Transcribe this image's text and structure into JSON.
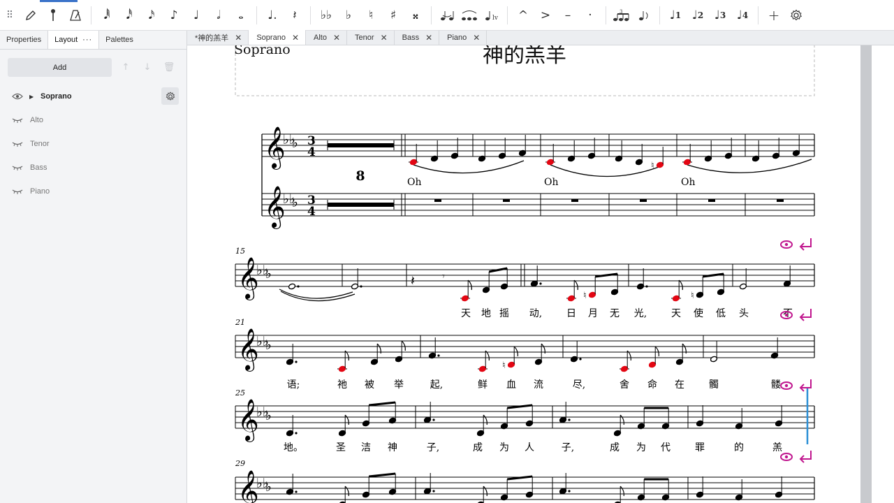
{
  "toolbar": {
    "items": [
      "pencil-icon",
      "sharp-pin-icon",
      "metronome-icon",
      "note-64th",
      "note-32nd",
      "note-16th",
      "note-8th",
      "note-quarter",
      "note-half",
      "note-whole",
      "dot",
      "rest",
      "double-flat",
      "flat",
      "natural",
      "sharp",
      "double-sharp",
      "tie",
      "slur",
      "tuplet",
      "accent-lv",
      "marcato",
      "accent",
      "tenuto",
      "staccato",
      "triplet",
      "flip",
      "voice-1",
      "voice-2",
      "voice-3",
      "voice-4",
      "add",
      "settings"
    ],
    "voices": [
      "1",
      "2",
      "3",
      "4"
    ]
  },
  "panel": {
    "tabs": [
      "Properties",
      "Layout",
      "Palettes"
    ],
    "active_tab": "Layout",
    "more_label": "···",
    "add_label": "Add",
    "instruments": [
      {
        "name": "Soprano",
        "visible": true,
        "expanded": false
      },
      {
        "name": "Alto",
        "visible": false
      },
      {
        "name": "Tenor",
        "visible": false
      },
      {
        "name": "Bass",
        "visible": false
      },
      {
        "name": "Piano",
        "visible": false
      }
    ]
  },
  "doc_tabs": [
    {
      "label": "*神的羔羊",
      "active": false
    },
    {
      "label": "Soprano",
      "active": true
    },
    {
      "label": "Alto",
      "active": false
    },
    {
      "label": "Tenor",
      "active": false
    },
    {
      "label": "Bass",
      "active": false
    },
    {
      "label": "Piano",
      "active": false
    }
  ],
  "score": {
    "part_name": "Soprano",
    "title": "神的羔羊",
    "rest_count": "8",
    "time_sig": [
      "3",
      "4"
    ],
    "measure_numbers": [
      "15",
      "21",
      "25",
      "29"
    ],
    "lyrics_oh": [
      "Oh",
      "Oh",
      "Oh"
    ],
    "lyrics_15": [
      "天",
      "地",
      "摇",
      "动,",
      "日",
      "月",
      "无",
      "光,",
      "天",
      "使",
      "低",
      "头",
      "不"
    ],
    "lyrics_21": [
      "语;",
      "祂",
      "被",
      "举",
      "起,",
      "鲜",
      "血",
      "流",
      "尽,",
      "舍",
      "命",
      "在",
      "髑",
      "髅"
    ],
    "lyrics_25": [
      "地。",
      "圣",
      "洁",
      "神",
      "子,",
      "成",
      "为",
      "人",
      "子,",
      "成",
      "为",
      "代",
      "罪",
      "的",
      "羔"
    ]
  },
  "colors": {
    "accent": "#3b73c9",
    "selected_note": "#e30613",
    "break_marker": "#c0168e",
    "cursor": "#2a8fd6"
  }
}
